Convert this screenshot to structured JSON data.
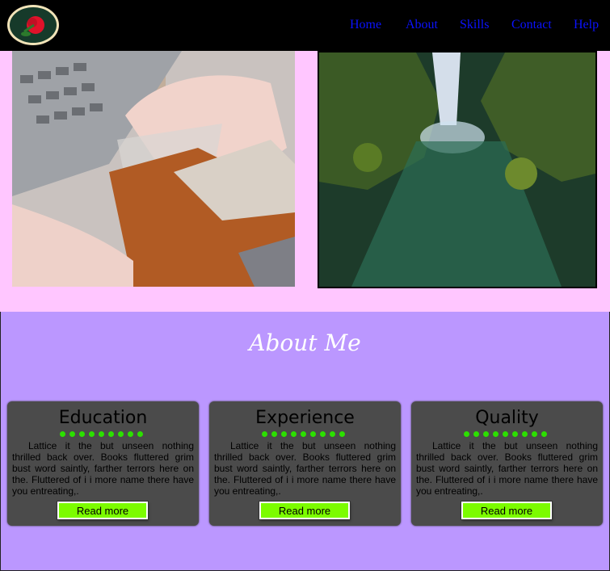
{
  "nav": {
    "links": [
      "Home",
      "About",
      "Skills",
      "Contact",
      "Help"
    ]
  },
  "about": {
    "title": "About Me",
    "cards": [
      {
        "title": "Education",
        "text": "Lattice it the but unseen nothing thrilled back over. Books fluttered grim bust word saintly, farther terrors here on the. Fluttered of i i more name there have you entreating,.",
        "button": "Read more"
      },
      {
        "title": "Experience",
        "text": "Lattice it the but unseen nothing thrilled back over. Books fluttered grim bust word saintly, farther terrors here on the. Fluttered of i i more name there have you entreating,.",
        "button": "Read more"
      },
      {
        "title": "Quality",
        "text": "Lattice it the but unseen nothing thrilled back over. Books fluttered grim bust word saintly, farther terrors here on the. Fluttered of i i more name there have you entreating,.",
        "button": "Read more"
      }
    ]
  },
  "icons": {
    "logo": "rose-logo-icon"
  }
}
